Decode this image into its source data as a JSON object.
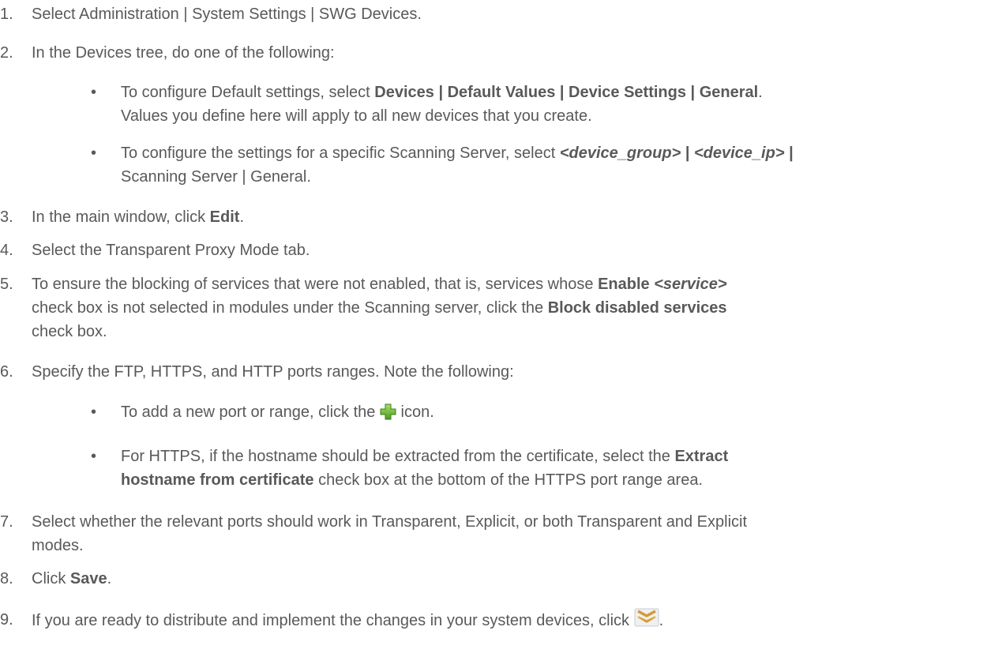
{
  "steps": [
    {
      "num": "1.",
      "text": "Select Administration | System Settings | SWG Devices."
    },
    {
      "num": "2.",
      "text": "In the Devices tree, do one of the following:",
      "bullets": [
        {
          "dot": "•",
          "line1_a": "To configure Default settings, select ",
          "line1_b": "Devices | Default Values | Device Settings | General",
          "line1_c": ".",
          "line2": "Values you define here will apply to all new devices that you create."
        },
        {
          "dot": "•",
          "line1_a": "To configure the settings for a specific Scanning Server, select ",
          "line1_b": "<device_group>",
          "line1_c": " | ",
          "line1_d": "<device_ip>",
          "line1_e": " |",
          "line2": "Scanning Server | General."
        }
      ]
    },
    {
      "num": "3.",
      "text_a": "In the main window, click ",
      "text_b": "Edit",
      "text_c": "."
    },
    {
      "num": "4.",
      "text": "Select the Transparent Proxy Mode tab."
    },
    {
      "num": "5.",
      "line1_a": "To ensure the blocking of services that were not enabled, that is, services whose ",
      "line1_b": "Enable",
      "line1_c": " ",
      "line1_d": "<service>",
      "line2_a": "check box is not selected in modules under the Scanning server, click the ",
      "line2_b": "Block disabled services",
      "line3": "check box."
    },
    {
      "num": "6.",
      "text": "Specify the FTP, HTTPS, and HTTP ports ranges. Note the following:",
      "bullets": [
        {
          "dot": "•",
          "text_a": "To add a new port or range, click the ",
          "text_c": " icon."
        },
        {
          "dot": "•",
          "line1_a": "For HTTPS, if the hostname should be extracted from the certificate, select the ",
          "line1_b": "Extract",
          "line2_a": "hostname from certificate",
          "line2_b": " check box at the bottom of the HTTPS port range area."
        }
      ]
    },
    {
      "num": "7.",
      "line1": "Select whether the relevant ports should work in Transparent, Explicit, or both Transparent and Explicit",
      "line2": "modes."
    },
    {
      "num": "8.",
      "text_a": "Click ",
      "text_b": "Save",
      "text_c": "."
    },
    {
      "num": "9.",
      "text_a": "If you are ready to distribute and implement the changes in your system devices, click ",
      "text_c": "."
    }
  ],
  "icons": {
    "add": "green-plus-icon",
    "distribute": "distribute-chevrons-icon"
  }
}
